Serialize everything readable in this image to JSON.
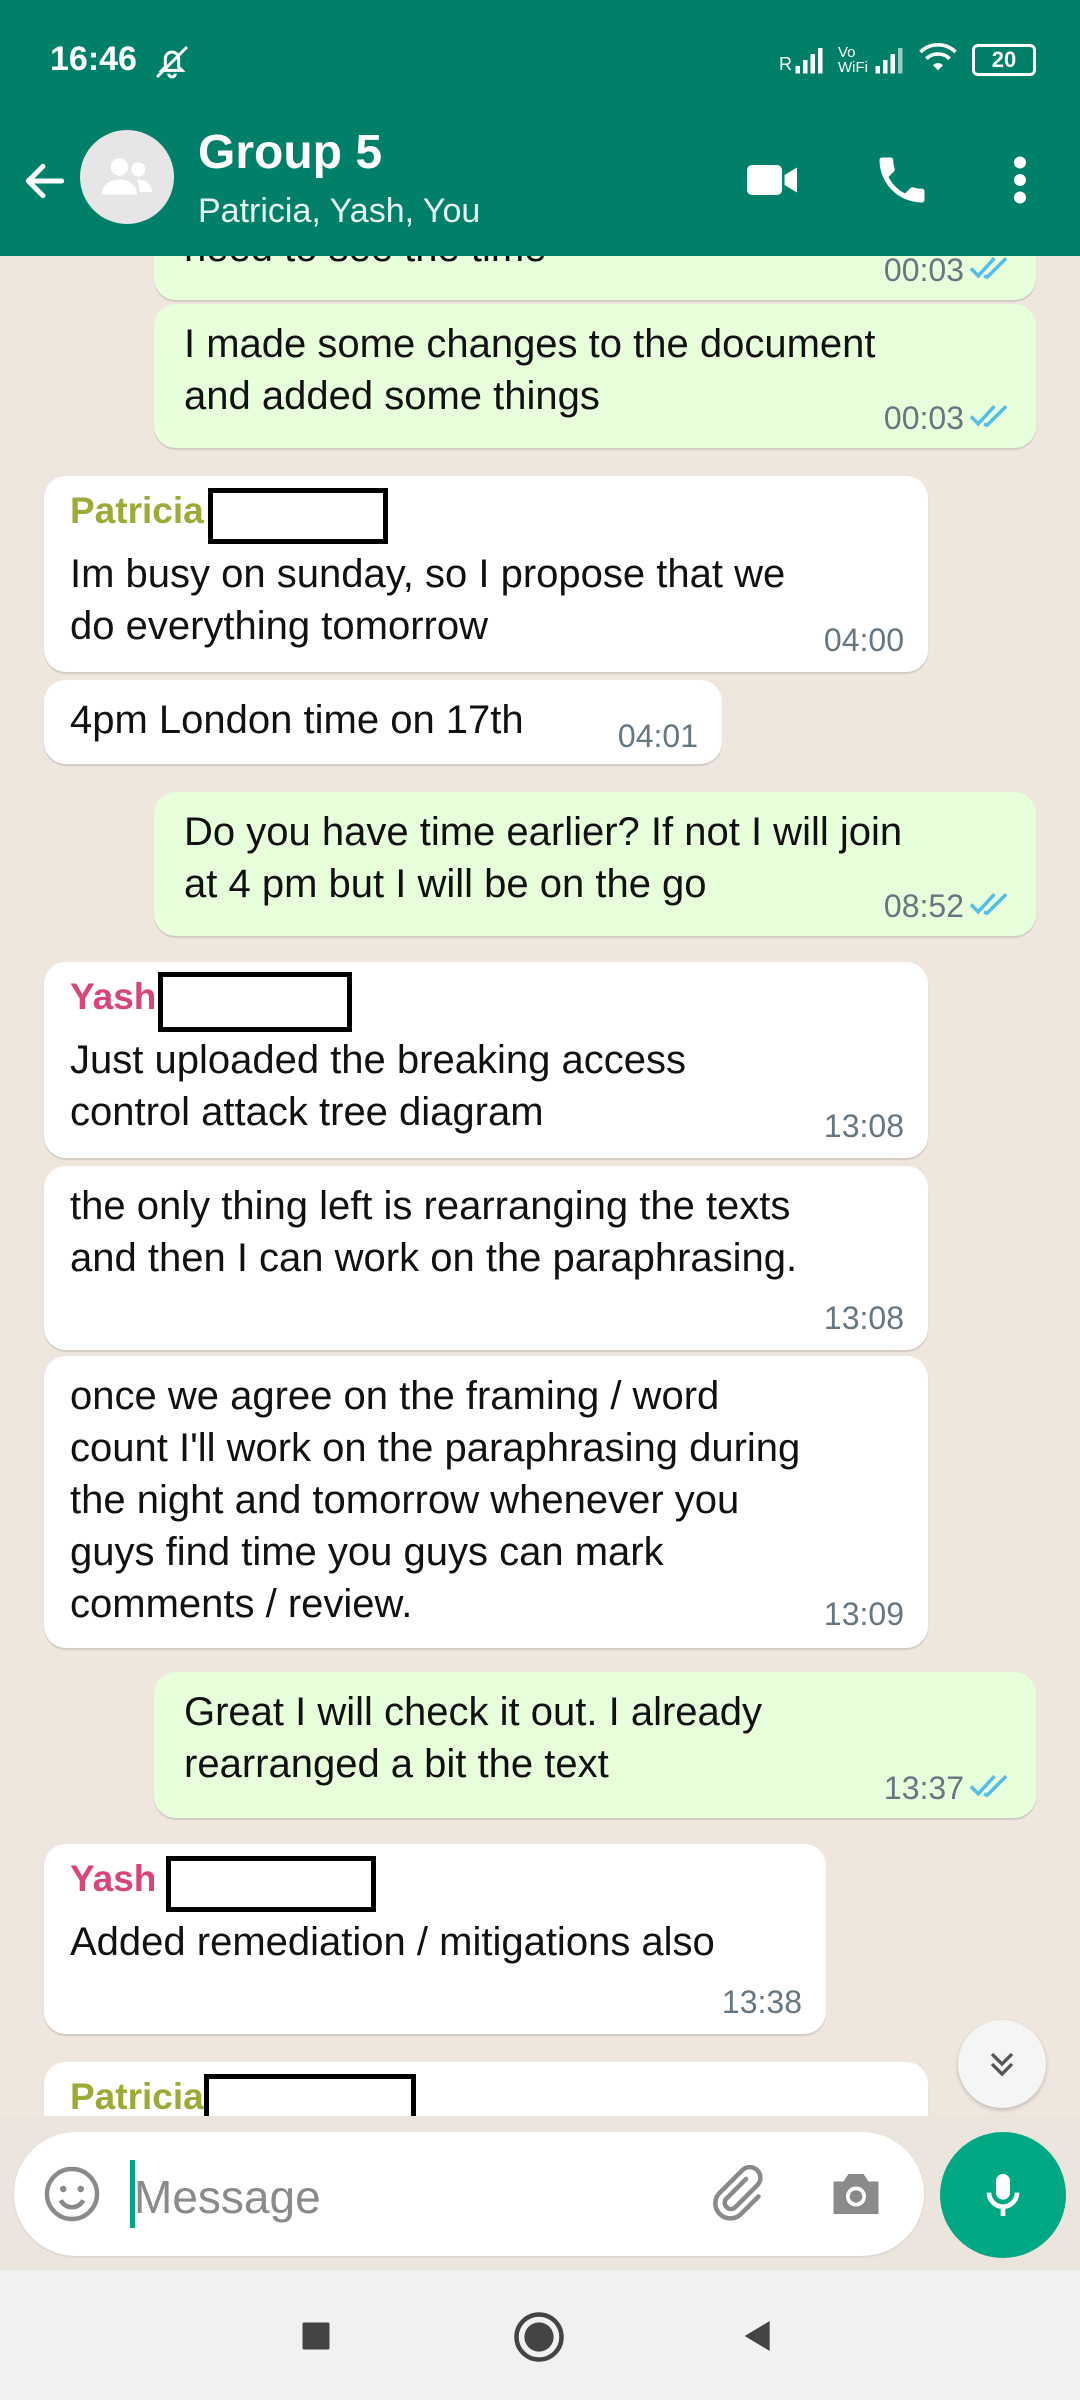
{
  "status_bar": {
    "time": "16:46",
    "net1": "R",
    "net2": "Vo WiFi",
    "battery": "20"
  },
  "header": {
    "title": "Group 5",
    "subtitle": "Patricia, Yash, You"
  },
  "messages": [
    {
      "dir": "out",
      "text": "need to see the time",
      "time": "00:03"
    },
    {
      "dir": "out",
      "text": "I made some changes to the document\nand added some things",
      "time": "00:03"
    },
    {
      "dir": "in",
      "sender": "Patricia",
      "text": "Im busy on sunday, so I propose that we\ndo everything tomorrow",
      "time": "04:00"
    },
    {
      "dir": "in",
      "text": "4pm London time on 17th",
      "time": "04:01"
    },
    {
      "dir": "out",
      "text": "Do you have time earlier? If not I will join\nat 4 pm but I will be on the go",
      "time": "08:52"
    },
    {
      "dir": "in",
      "sender": "Yash",
      "text": "Just uploaded the breaking access\ncontrol attack tree diagram",
      "time": "13:08"
    },
    {
      "dir": "in",
      "text": "the only thing left is rearranging the texts\nand then I can work on the paraphrasing.",
      "time": "13:08"
    },
    {
      "dir": "in",
      "text": "once we agree on the framing / word\ncount I'll work on the paraphrasing during\nthe night and tomorrow whenever you\nguys find time you guys can mark\ncomments / review.",
      "time": "13:09"
    },
    {
      "dir": "out",
      "text": "Great I will check it out. I already\nrearranged a bit the text",
      "time": "13:37"
    },
    {
      "dir": "in",
      "sender": "Yash",
      "text": "Added remediation / mitigations also",
      "time": "13:38"
    },
    {
      "dir": "in",
      "sender": "Patricia",
      "text": "",
      "time": ""
    }
  ],
  "input": {
    "placeholder": "Message"
  },
  "colors": {
    "header": "#008069",
    "outgoing": "#e7ffdb",
    "accent": "#00a884",
    "patricia": "#9eaa37",
    "yash": "#d9457a",
    "ticks": "#53bdeb"
  },
  "icons": [
    "bell-off-icon",
    "signal-icon",
    "wifi-icon",
    "battery-icon",
    "back-arrow-icon",
    "group-avatar-icon",
    "video-call-icon",
    "voice-call-icon",
    "more-options-icon",
    "double-check-icon",
    "scroll-down-icon",
    "emoji-icon",
    "attach-icon",
    "camera-icon",
    "mic-icon",
    "nav-recents-icon",
    "nav-home-icon",
    "nav-back-icon"
  ]
}
